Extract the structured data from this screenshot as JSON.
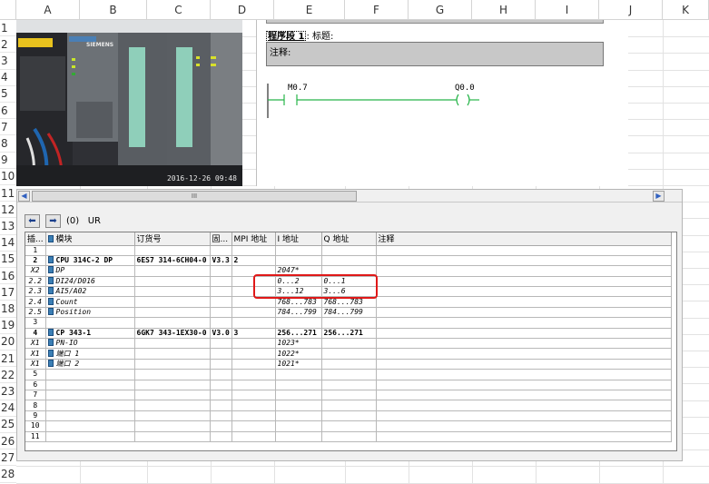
{
  "spreadsheet": {
    "columns": [
      "A",
      "B",
      "C",
      "D",
      "E",
      "F",
      "G",
      "H",
      "I",
      "J",
      "K"
    ],
    "rows": [
      "1",
      "2",
      "3",
      "4",
      "5",
      "6",
      "7",
      "8",
      "9",
      "10",
      "11",
      "12",
      "13",
      "14",
      "15",
      "16",
      "17",
      "18",
      "19",
      "20",
      "21",
      "22",
      "23",
      "24",
      "25",
      "26",
      "27",
      "28"
    ]
  },
  "photo": {
    "brand": "SIEMENS",
    "stamp": "2016-12-26 09:48"
  },
  "ladder": {
    "segment_label": "程序段 1",
    "title_label": ": 标题:",
    "comment_label": "注释:",
    "contact": "M0.7",
    "coil": "Q0.0"
  },
  "hwconfig": {
    "scroll_thumb": "III",
    "rack": "(0)   UR",
    "columns": [
      "插...",
      "模块",
      "订货号",
      "固...",
      "MPI 地址",
      "I 地址",
      "Q 地址",
      "注释"
    ],
    "rows": [
      {
        "slot": "1",
        "module": "",
        "order": "",
        "fw": "",
        "mpi": "",
        "i": "",
        "q": "",
        "style": "plain",
        "icon": false
      },
      {
        "slot": "2",
        "module": "CPU 314C-2 DP",
        "order": "6ES7 314-6CH04-0",
        "fw": "V3.3",
        "mpi": "2",
        "i": "",
        "q": "",
        "style": "bold",
        "icon": true
      },
      {
        "slot": "X2",
        "module": "DP",
        "order": "",
        "fw": "",
        "mpi": "",
        "i": "2047*",
        "q": "",
        "style": "ital",
        "icon": true
      },
      {
        "slot": "2.2",
        "module": "DI24/D016",
        "order": "",
        "fw": "",
        "mpi": "",
        "i": "0...2",
        "q": "0...1",
        "style": "ital",
        "icon": true
      },
      {
        "slot": "2.3",
        "module": "AI5/A02",
        "order": "",
        "fw": "",
        "mpi": "",
        "i": "3...12",
        "q": "3...6",
        "style": "ital",
        "icon": true
      },
      {
        "slot": "2.4",
        "module": "Count",
        "order": "",
        "fw": "",
        "mpi": "",
        "i": "768...783",
        "q": "768...783",
        "style": "ital",
        "icon": true
      },
      {
        "slot": "2.5",
        "module": "Position",
        "order": "",
        "fw": "",
        "mpi": "",
        "i": "784...799",
        "q": "784...799",
        "style": "ital",
        "icon": true
      },
      {
        "slot": "3",
        "module": "",
        "order": "",
        "fw": "",
        "mpi": "",
        "i": "",
        "q": "",
        "style": "plain",
        "icon": false
      },
      {
        "slot": "4",
        "module": "CP 343-1",
        "order": "6GK7 343-1EX30-0",
        "fw": "V3.0",
        "mpi": "3",
        "i": "256...271",
        "q": "256...271",
        "style": "bold",
        "icon": true
      },
      {
        "slot": "X1",
        "module": "PN-IO",
        "order": "",
        "fw": "",
        "mpi": "",
        "i": "1023*",
        "q": "",
        "style": "ital",
        "icon": true
      },
      {
        "slot": "X1",
        "module": "端口 1",
        "order": "",
        "fw": "",
        "mpi": "",
        "i": "1022*",
        "q": "",
        "style": "ital",
        "icon": true
      },
      {
        "slot": "X1",
        "module": "端口 2",
        "order": "",
        "fw": "",
        "mpi": "",
        "i": "1021*",
        "q": "",
        "style": "ital",
        "icon": true
      },
      {
        "slot": "5",
        "module": "",
        "order": "",
        "fw": "",
        "mpi": "",
        "i": "",
        "q": "",
        "style": "plain",
        "icon": false
      },
      {
        "slot": "6",
        "module": "",
        "order": "",
        "fw": "",
        "mpi": "",
        "i": "",
        "q": "",
        "style": "plain",
        "icon": false
      },
      {
        "slot": "7",
        "module": "",
        "order": "",
        "fw": "",
        "mpi": "",
        "i": "",
        "q": "",
        "style": "plain",
        "icon": false
      },
      {
        "slot": "8",
        "module": "",
        "order": "",
        "fw": "",
        "mpi": "",
        "i": "",
        "q": "",
        "style": "plain",
        "icon": false
      },
      {
        "slot": "9",
        "module": "",
        "order": "",
        "fw": "",
        "mpi": "",
        "i": "",
        "q": "",
        "style": "plain",
        "icon": false
      },
      {
        "slot": "10",
        "module": "",
        "order": "",
        "fw": "",
        "mpi": "",
        "i": "",
        "q": "",
        "style": "plain",
        "icon": false
      },
      {
        "slot": "11",
        "module": "",
        "order": "",
        "fw": "",
        "mpi": "",
        "i": "",
        "q": "",
        "style": "plain",
        "icon": false
      }
    ]
  },
  "colors": {
    "highlight_box": "#e01818",
    "ladder_green": "#27b54a",
    "module_icon": "#3b7fb5"
  }
}
